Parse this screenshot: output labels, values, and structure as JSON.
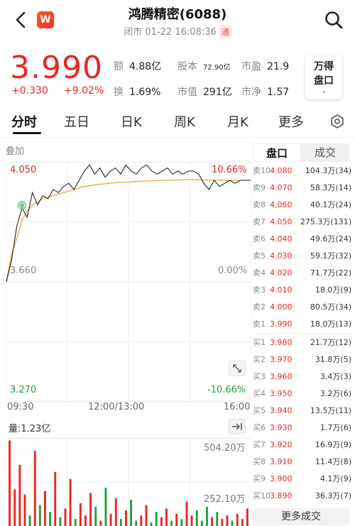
{
  "header": {
    "title": "鸿腾精密(6088)",
    "status": "闭市 01-22 16:08:36",
    "connect_badge": "通",
    "logo_letter": "W"
  },
  "quote": {
    "price": "3.990",
    "change": "+0.330",
    "change_pct": "+9.02%",
    "metrics": [
      {
        "label": "额",
        "value": "4.88亿"
      },
      {
        "label": "股本",
        "value": "72.90亿"
      },
      {
        "label": "市盈",
        "value": "21.9"
      },
      {
        "label": "换",
        "value": "1.69%"
      },
      {
        "label": "市值",
        "value": "291亿"
      },
      {
        "label": "市净",
        "value": "1.57"
      }
    ],
    "wande_line1": "万得",
    "wande_line2": "盘口"
  },
  "tabs": [
    "分时",
    "五日",
    "日K",
    "周K",
    "月K",
    "更多"
  ],
  "chart": {
    "overlay_label": "叠加",
    "price_high": "4.050",
    "price_mid": "3.660",
    "price_low": "3.270",
    "pct_high": "10.66%",
    "pct_mid": "0.00%",
    "pct_low": "-10.66%",
    "times": [
      "09:30",
      "12:00/13:00",
      "16:00"
    ],
    "marker": "9",
    "volume_label": "量:1.23亿",
    "vol_max": "504.20万",
    "vol_mid": "252.10万"
  },
  "chart_data": {
    "type": "line",
    "title": "",
    "ylim": [
      3.27,
      4.05
    ],
    "price": [
      3.66,
      3.73,
      3.84,
      3.9,
      3.87,
      3.95,
      3.91,
      3.94,
      3.93,
      3.96,
      3.95,
      3.97,
      3.98,
      3.96,
      3.99,
      4.02,
      4.04,
      4.01,
      4.03,
      4.0,
      4.02,
      4.03,
      4.01,
      4.04,
      4.02,
      4.01,
      4.03,
      4.04,
      4.02,
      4.01,
      4.02,
      4.03,
      4.01,
      4.02,
      4.01,
      4.02,
      4.02,
      4.01,
      3.98,
      3.96,
      3.99,
      3.97,
      3.98,
      3.99,
      3.98,
      3.99,
      3.99,
      3.99
    ],
    "avg": [
      3.66,
      3.75,
      3.8,
      3.86,
      3.89,
      3.91,
      3.92,
      3.93,
      3.935,
      3.94,
      3.945,
      3.95,
      3.955,
      3.96,
      3.965,
      3.97,
      3.972,
      3.975,
      3.977,
      3.979,
      3.981,
      3.982,
      3.983,
      3.984,
      3.985,
      3.986,
      3.987,
      3.988,
      3.988,
      3.989,
      3.99,
      3.99,
      3.991,
      3.991,
      3.992,
      3.992,
      3.992,
      3.992,
      3.991,
      3.99,
      3.99,
      3.99,
      3.99,
      3.99,
      3.99,
      3.99,
      3.99,
      3.99
    ],
    "volume": [
      4.9,
      2.1,
      3.5,
      1.8,
      0.6,
      4.3,
      1.2,
      2.0,
      0.8,
      3.1,
      0.5,
      1.0,
      2.7,
      0.4,
      1.3,
      0.6,
      1.9,
      1.1,
      0.3,
      2.2,
      0.7,
      1.6,
      0.4,
      0.9,
      1.5,
      0.3,
      0.6,
      1.2,
      0.2,
      0.8,
      0.5,
      1.0,
      0.3,
      0.7,
      0.4,
      1.4,
      0.6,
      0.9,
      0.3,
      1.1,
      0.5,
      0.8,
      0.4,
      0.6,
      0.3,
      0.7,
      0.4,
      1.0
    ]
  },
  "orderbook": {
    "tab_active": "盘口",
    "tab_other": "成交",
    "sells": [
      {
        "lv": "卖10",
        "price": "4.080",
        "vol": "104.3万(34)"
      },
      {
        "lv": "卖9",
        "price": "4.070",
        "vol": "58.3万(14)"
      },
      {
        "lv": "卖8",
        "price": "4.060",
        "vol": "40.1万(24)"
      },
      {
        "lv": "卖7",
        "price": "4.050",
        "vol": "275.3万(131)"
      },
      {
        "lv": "卖6",
        "price": "4.040",
        "vol": "49.6万(24)"
      },
      {
        "lv": "卖5",
        "price": "4.030",
        "vol": "59.1万(32)"
      },
      {
        "lv": "卖4",
        "price": "4.020",
        "vol": "71.7万(22)"
      },
      {
        "lv": "卖3",
        "price": "4.010",
        "vol": "18.0万(9)"
      },
      {
        "lv": "卖2",
        "price": "4.000",
        "vol": "80.5万(34)"
      },
      {
        "lv": "卖1",
        "price": "3.990",
        "vol": "18.0万(13)"
      }
    ],
    "buys": [
      {
        "lv": "买1",
        "price": "3.980",
        "vol": "21.7万(12)"
      },
      {
        "lv": "买2",
        "price": "3.970",
        "vol": "31.8万(5)"
      },
      {
        "lv": "买3",
        "price": "3.960",
        "vol": "3.4万(3)"
      },
      {
        "lv": "买4",
        "price": "3.950",
        "vol": "3.2万(6)"
      },
      {
        "lv": "买5",
        "price": "3.940",
        "vol": "13.5万(11)"
      },
      {
        "lv": "买6",
        "price": "3.930",
        "vol": "1.7万(6)"
      },
      {
        "lv": "买7",
        "price": "3.920",
        "vol": "16.9万(9)"
      },
      {
        "lv": "买8",
        "price": "3.910",
        "vol": "11.4万(8)"
      },
      {
        "lv": "买9",
        "price": "3.900",
        "vol": "4.1万(9)"
      },
      {
        "lv": "买10",
        "price": "3.890",
        "vol": "36.3万(7)"
      }
    ],
    "more_label": "更多成交"
  },
  "colors": {
    "up": "#e8271f",
    "down": "#1fa13a",
    "avg": "#e6a93a",
    "line": "#222222"
  }
}
